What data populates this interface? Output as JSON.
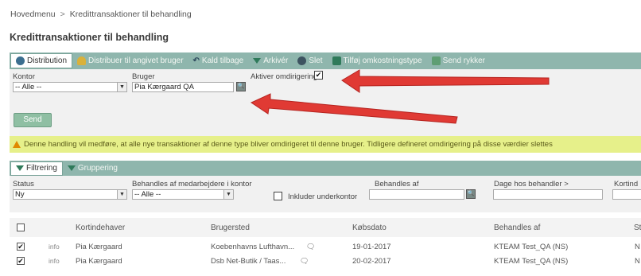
{
  "breadcrumb": {
    "home": "Hovedmenu",
    "separator": ">",
    "current": "Kredittransaktioner til behandling"
  },
  "page_title": "Kredittransaktioner til behandling",
  "toolbar": {
    "distribution": "Distribution",
    "distribute_user": "Distribuer til angivet bruger",
    "recall": "Kald tilbage",
    "archive": "Arkivér",
    "delete": "Slet",
    "add_cost_type": "Tilføj omkostningstype",
    "send_reminder": "Send rykker"
  },
  "form": {
    "kontor_label": "Kontor",
    "kontor_value": "-- Alle --",
    "bruger_label": "Bruger",
    "bruger_value": "Pia Kærgaard QA",
    "redirect_label": "Aktiver omdirigering",
    "redirect_checked": "✔",
    "send_label": "Send"
  },
  "warning_text": "Denne handling vil medføre, at alle nye transaktioner af denne type bliver omdirigeret til denne bruger. Tidligere defineret omdirigering på disse værdier slettes",
  "filter_tabs": {
    "filter": "Filtrering",
    "group": "Gruppering"
  },
  "filters": {
    "status_label": "Status",
    "status_value": "Ny",
    "handled_by_staff_label": "Behandles af medarbejdere i kontor",
    "handled_by_staff_value": "-- Alle --",
    "include_suboffice_label": "Inkluder underkontor",
    "handled_by_label": "Behandles af",
    "days_label": "Dage hos behandler >",
    "card_label": "Kortind"
  },
  "table": {
    "columns": [
      "Kortindehaver",
      "Brugersted",
      "Købsdato",
      "Behandles af",
      "St"
    ],
    "rows": [
      {
        "checked": "✔",
        "info": "info",
        "holder": "Pia Kærgaard",
        "place": "Koebenhavns Lufthavn...",
        "date": "19-01-2017",
        "handler": "KTEAM Test_QA (NS)",
        "status": "N"
      },
      {
        "checked": "✔",
        "info": "info",
        "holder": "Pia Kærgaard",
        "place": "Dsb Net-Butik / Taas...",
        "date": "20-02-2017",
        "handler": "KTEAM Test_QA (NS)",
        "status": "N"
      }
    ]
  },
  "colors": {
    "toolbar": "#8fb6ad",
    "warning": "#e6f08a",
    "arrow": "#e03a34"
  }
}
